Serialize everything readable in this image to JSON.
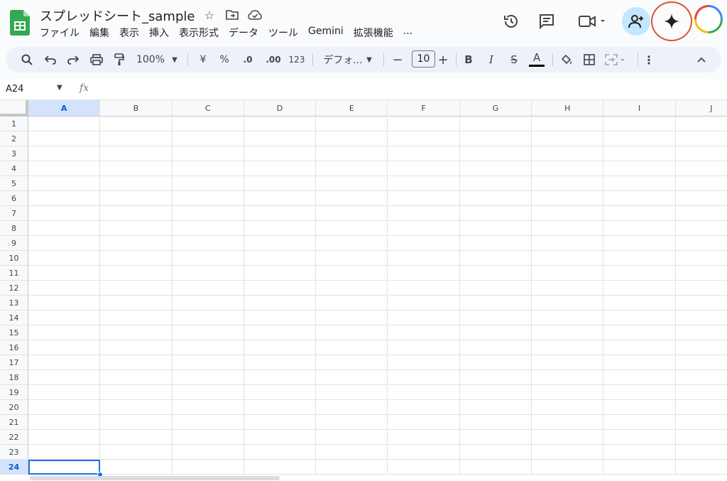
{
  "app": {
    "doc_title": "スプレッドシート_sample",
    "menu": [
      "ファイル",
      "編集",
      "表示",
      "挿入",
      "表示形式",
      "データ",
      "ツール",
      "Gemini",
      "拡張機能",
      "..."
    ],
    "accent": "#1a73e8",
    "highlight_circle_color": "#d9542d"
  },
  "toolbar": {
    "zoom": "100%",
    "currency": "¥",
    "percent": "%",
    "dec_decrease": ".0",
    "dec_increase": ".00",
    "num_format": "123",
    "font": "デフォ...",
    "font_size": "10",
    "bold": "B",
    "italic": "I",
    "strike": "S",
    "text_color": "A"
  },
  "formula_bar": {
    "name_box": "A24",
    "fx": "fx",
    "value": ""
  },
  "grid": {
    "columns": [
      "A",
      "B",
      "C",
      "D",
      "E",
      "F",
      "G",
      "H",
      "I",
      "J"
    ],
    "rows": [
      "1",
      "2",
      "3",
      "4",
      "5",
      "6",
      "7",
      "8",
      "9",
      "10",
      "11",
      "12",
      "13",
      "14",
      "15",
      "16",
      "17",
      "18",
      "19",
      "20",
      "21",
      "22",
      "23",
      "24"
    ],
    "selected_cell": "A24"
  }
}
